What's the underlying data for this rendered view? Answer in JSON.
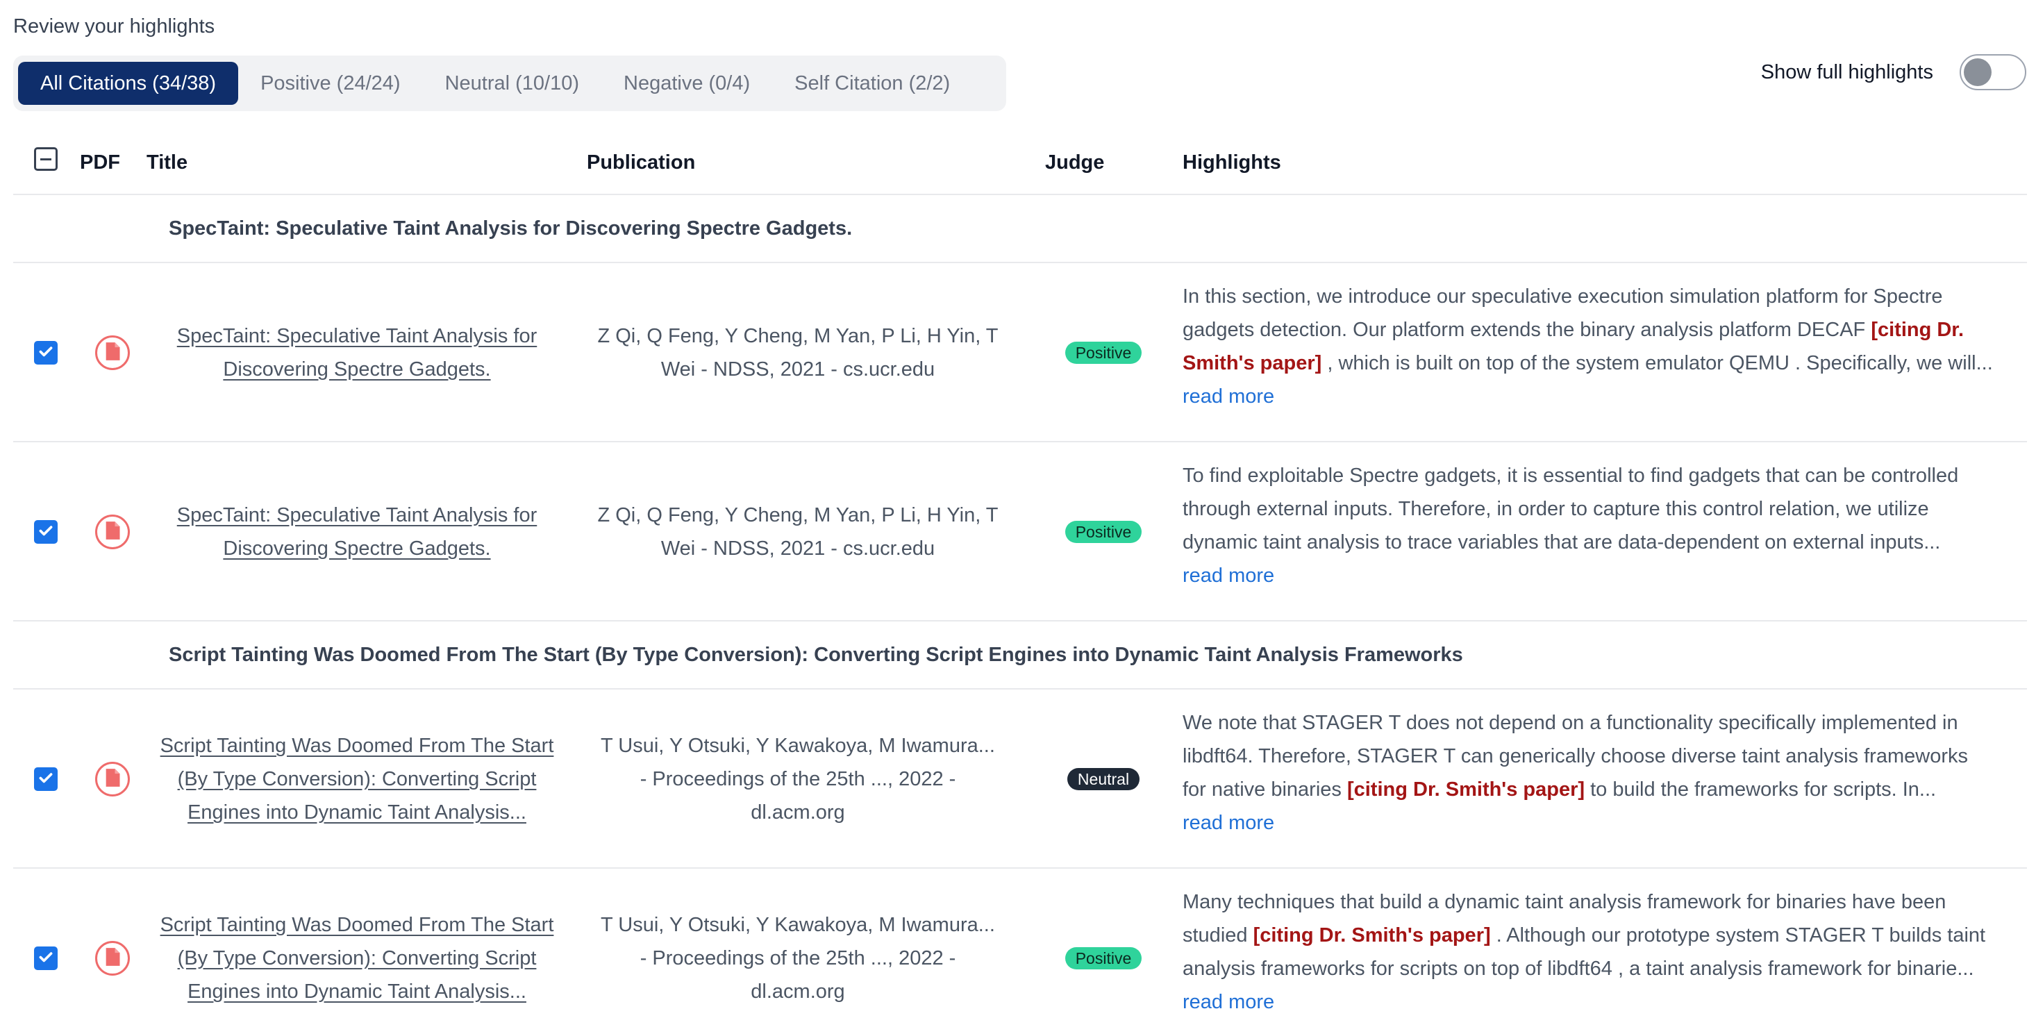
{
  "page": {
    "heading": "Review your highlights"
  },
  "tabs": [
    {
      "label": "All Citations (34/38)",
      "active": true
    },
    {
      "label": "Positive (24/24)",
      "active": false
    },
    {
      "label": "Neutral (10/10)",
      "active": false
    },
    {
      "label": "Negative (0/4)",
      "active": false
    },
    {
      "label": "Self Citation (2/2)",
      "active": false
    }
  ],
  "toggle": {
    "label": "Show full highlights",
    "on": false
  },
  "columns": {
    "pdf": "PDF",
    "title": "Title",
    "publication": "Publication",
    "judge": "Judge",
    "highlights": "Highlights"
  },
  "groups": [
    {
      "header": "SpecTaint: Speculative Taint Analysis for Discovering Spectre Gadgets.",
      "rows": [
        {
          "checked": true,
          "title_lines": [
            "SpecTaint: Speculative Taint Analysis for",
            "Discovering Spectre Gadgets."
          ],
          "pub_lines": [
            "Z Qi, Q Feng, Y Cheng, M Yan, P Li, H Yin, T",
            "Wei - NDSS, 2021 - cs.ucr.edu"
          ],
          "judge": "Positive",
          "highlight_lines": [
            [
              {
                "t": "In this section, we introduce our speculative execution simulation platform for Spectre"
              }
            ],
            [
              {
                "t": "gadgets detection. Our platform extends the binary analysis platform DECAF "
              },
              {
                "t": "[citing Dr.",
                "cite": true
              }
            ],
            [
              {
                "t": "Smith's paper]",
                "cite": true
              },
              {
                "t": " , which is built on top of the system emulator QEMU . Specifically, we will..."
              }
            ]
          ],
          "read_more": "read more"
        },
        {
          "checked": true,
          "title_lines": [
            "SpecTaint: Speculative Taint Analysis for",
            "Discovering Spectre Gadgets."
          ],
          "pub_lines": [
            "Z Qi, Q Feng, Y Cheng, M Yan, P Li, H Yin, T",
            "Wei - NDSS, 2021 - cs.ucr.edu"
          ],
          "judge": "Positive",
          "highlight_lines": [
            [
              {
                "t": "To find exploitable Spectre gadgets, it is essential to find gadgets that can be controlled"
              }
            ],
            [
              {
                "t": "through external inputs. Therefore, in order to capture this control relation, we utilize"
              }
            ],
            [
              {
                "t": "dynamic taint analysis to trace variables that are data-dependent on external inputs..."
              }
            ]
          ],
          "read_more": "read more"
        }
      ]
    },
    {
      "header": "Script Tainting Was Doomed From The Start (By Type Conversion): Converting Script Engines into Dynamic Taint Analysis Frameworks",
      "rows": [
        {
          "checked": true,
          "title_lines": [
            "Script Tainting Was Doomed From The Start",
            "(By Type Conversion): Converting Script",
            "Engines into Dynamic Taint Analysis..."
          ],
          "pub_lines": [
            "T Usui, Y Otsuki, Y Kawakoya, M Iwamura...",
            "- Proceedings of the 25th ..., 2022 -",
            "dl.acm.org"
          ],
          "judge": "Neutral",
          "highlight_lines": [
            [
              {
                "t": "We note that STAGER T does not depend on a functionality specifically implemented in"
              }
            ],
            [
              {
                "t": "libdft64. Therefore, STAGER T can generically choose diverse taint analysis frameworks"
              }
            ],
            [
              {
                "t": "for native binaries "
              },
              {
                "t": "[citing Dr. Smith's paper]",
                "cite": true
              },
              {
                "t": " to build the frameworks for scripts. In..."
              }
            ]
          ],
          "read_more": "read more"
        },
        {
          "checked": true,
          "title_lines": [
            "Script Tainting Was Doomed From The Start",
            "(By Type Conversion): Converting Script",
            "Engines into Dynamic Taint Analysis..."
          ],
          "pub_lines": [
            "T Usui, Y Otsuki, Y Kawakoya, M Iwamura...",
            "- Proceedings of the 25th ..., 2022 -",
            "dl.acm.org"
          ],
          "judge": "Positive",
          "highlight_lines": [
            [
              {
                "t": "Many techniques that build a dynamic taint analysis framework for binaries have been"
              }
            ],
            [
              {
                "t": "studied "
              },
              {
                "t": "[citing Dr. Smith's paper]",
                "cite": true
              },
              {
                "t": " . Although our prototype system STAGER T builds taint"
              }
            ],
            [
              {
                "t": "analysis frameworks for scripts on top of libdft64 , a taint analysis framework for binarie..."
              }
            ]
          ],
          "read_more": "read more"
        }
      ]
    }
  ],
  "colors": {
    "active_tab": "#0f2e6b",
    "checkbox": "#1a73e8",
    "positive_badge": "#2fd39b",
    "neutral_badge": "#1f2937",
    "citation": "#a31515",
    "link": "#1f6fd6",
    "pdf_icon": "#ef6b6b"
  },
  "icons": {
    "checkbox": "checkmark-icon",
    "pdf": "pdf-file-icon",
    "select_all": "minus-icon"
  }
}
